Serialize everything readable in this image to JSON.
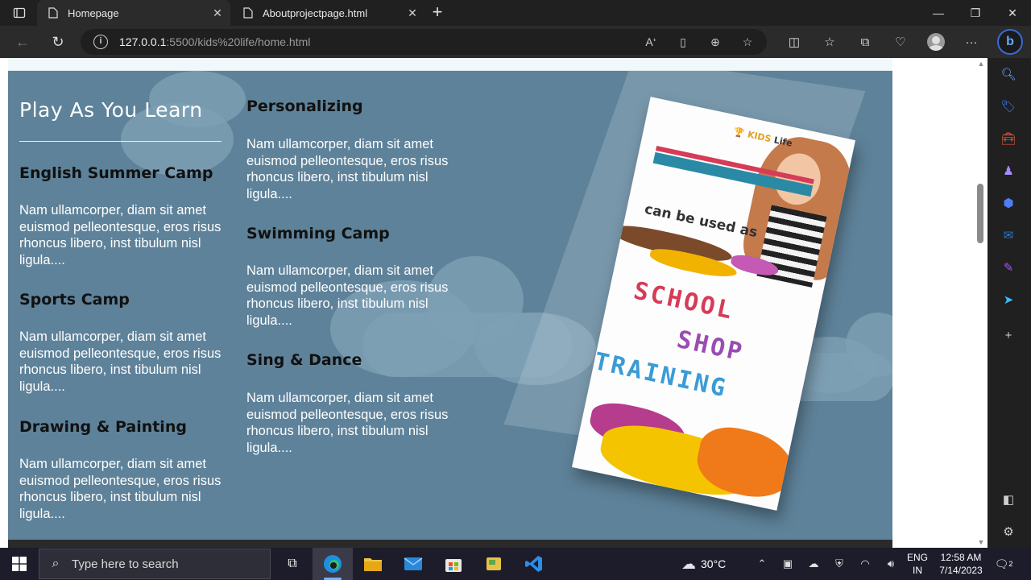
{
  "browser": {
    "tabs": [
      {
        "title": "Homepage",
        "active": true
      },
      {
        "title": "Aboutprojectpage.html",
        "active": false
      }
    ],
    "address": {
      "host": "127.0.0.1",
      "path": ":5500/kids%20life/home.html"
    },
    "icons": {
      "back": "back-arrow-icon",
      "refresh": "refresh-icon",
      "site_info": "info-icon",
      "read_aloud": "read-aloud-icon",
      "immersive_reader": "immersive-reader-icon",
      "zoom": "zoom-icon",
      "favorite": "star-icon",
      "split": "split-screen-icon",
      "favorites": "favorites-icon",
      "collections": "collections-icon",
      "performance": "heartbeat-icon",
      "profile": "profile-icon",
      "more": "more-icon",
      "copilot": "bing-icon"
    }
  },
  "page": {
    "title": "Play As You Learn",
    "column1": [
      {
        "heading": "English Summer Camp",
        "text": "Nam ullamcorper, diam sit amet euismod pelleontesque, eros risus rhoncus libero, inst tibulum nisl ligula...."
      },
      {
        "heading": "Sports Camp",
        "text": "Nam ullamcorper, diam sit amet euismod pelleontesque, eros risus rhoncus libero, inst tibulum nisl ligula...."
      },
      {
        "heading": "Drawing & Painting",
        "text": "Nam ullamcorper, diam sit amet euismod pelleontesque, eros risus rhoncus libero, inst tibulum nisl ligula...."
      }
    ],
    "column2": [
      {
        "heading": "Personalizing",
        "text": "Nam ullamcorper, diam sit amet euismod pelleontesque, eros risus rhoncus libero, inst tibulum nisl ligula...."
      },
      {
        "heading": "Swimming Camp",
        "text": "Nam ullamcorper, diam sit amet euismod pelleontesque, eros risus rhoncus libero, inst tibulum nisl ligula...."
      },
      {
        "heading": "Sing & Dance",
        "text": "Nam ullamcorper, diam sit amet euismod pelleontesque, eros risus rhoncus libero, inst tibulum nisl ligula...."
      }
    ],
    "brochure": {
      "logo_prefix": "KIDS",
      "logo_suffix": "Life",
      "tagline": "can be used as",
      "words": [
        "SCHOOL",
        "SHOP",
        "TRAINING"
      ]
    },
    "colors": {
      "hero_bg": "#5e8299",
      "heading": "#111111",
      "body_text": "#ffffff"
    }
  },
  "taskbar": {
    "search_placeholder": "Type here to search",
    "temperature": "30°C",
    "language_line1": "ENG",
    "language_line2": "IN",
    "time": "12:58 AM",
    "date": "7/14/2023",
    "notification_count": "2"
  }
}
